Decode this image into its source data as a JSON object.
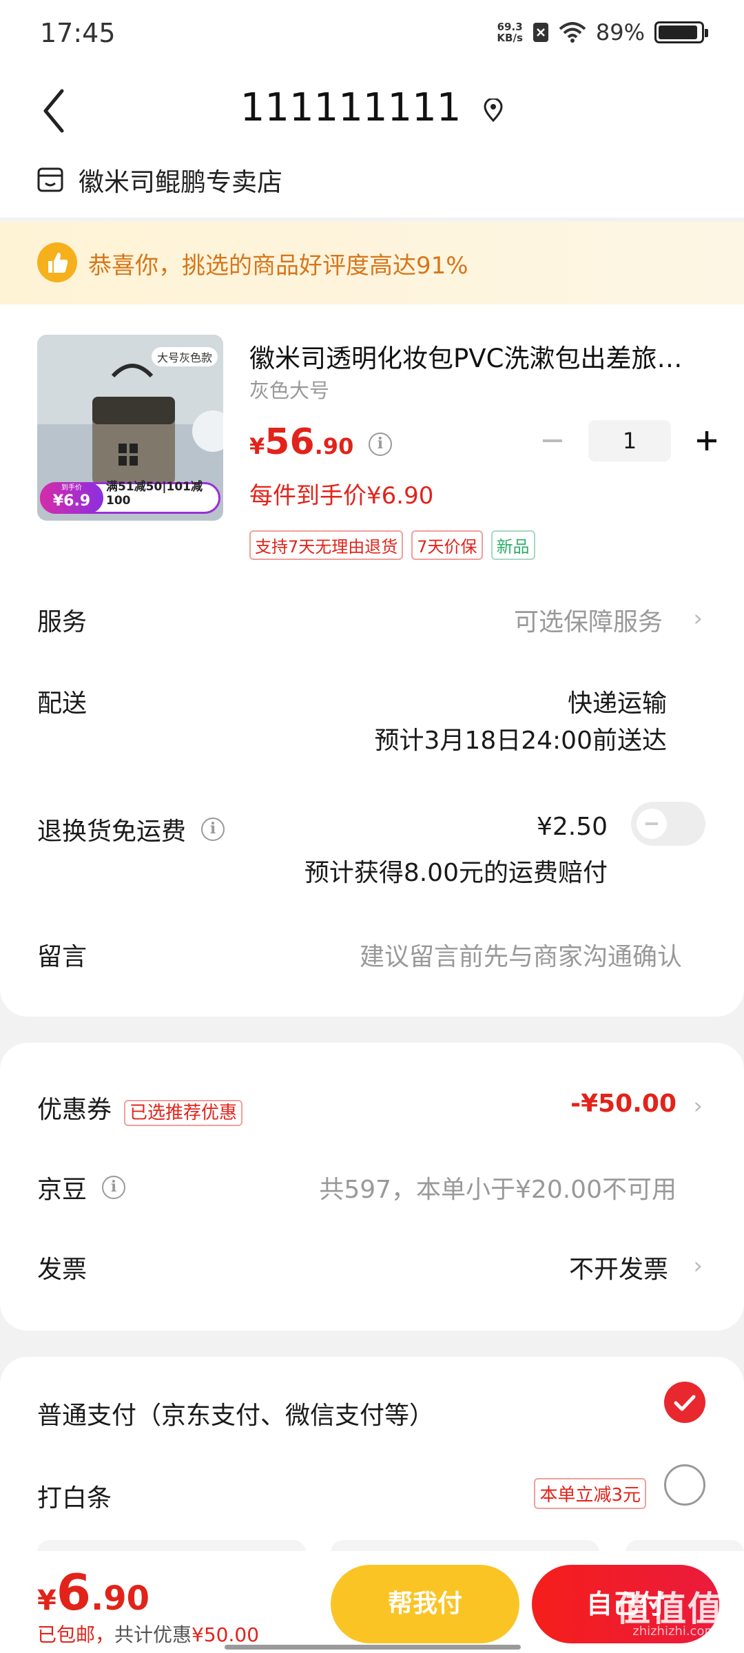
{
  "status_bar": {
    "time": "17:45",
    "speed_value": "69.3",
    "speed_unit": "KB/s",
    "battery": "89%"
  },
  "header": {
    "title": "111111111",
    "store_name": "徽米司鲲鹏专卖店"
  },
  "banner": {
    "text": "恭喜你，挑选的商品好评度高达91%"
  },
  "product": {
    "name": "徽米司透明化妆包PVC洗漱包出差旅…",
    "variant": "灰色大号",
    "price_symbol": "¥",
    "price_int": "56",
    "price_dec": ".90",
    "quantity": "1",
    "per_item_price": "每件到手价¥6.90",
    "tags": [
      "支持7天无理由退货",
      "7天价保",
      "新品"
    ],
    "image_badge": "大号灰色款",
    "image_price_label": "到手价",
    "image_price": "¥6.9",
    "image_promo": "满51减50|101减100"
  },
  "rows": {
    "service_label": "服务",
    "service_value": "可选保障服务",
    "delivery_label": "配送",
    "delivery_value": "快递运输",
    "delivery_eta": "预计3月18日24:00前送达",
    "return_label": "退换货免运费",
    "return_price": "¥2.50",
    "return_note": "预计获得8.00元的运费赔付",
    "message_label": "留言",
    "message_placeholder": "建议留言前先与商家沟通确认"
  },
  "discounts": {
    "coupon_label": "优惠券",
    "coupon_tag": "已选推荐优惠",
    "coupon_value": "-¥50.00",
    "jingdou_label": "京豆",
    "jingdou_value": "共597，本单小于¥20.00不可用",
    "invoice_label": "发票",
    "invoice_value": "不开发票"
  },
  "payment": {
    "normal_label": "普通支付（京东支付、微信支付等）",
    "baitiao_label": "打白条",
    "baitiao_tag": "本单立减3元"
  },
  "bottom": {
    "total_symbol": "¥",
    "total_int": "6",
    "total_dec": ".90",
    "shipping_note": "已包邮，",
    "discount_note": "共计优惠",
    "discount_amount": "¥50.00",
    "help_pay": "帮我付",
    "self_pay": "自己付"
  },
  "watermark": {
    "text": "值值值",
    "site": "zhizhizhi.com"
  },
  "colors": {
    "accent_red": "#e2231a",
    "help_yellow": "#fbc425",
    "banner_orange": "#d6761a"
  }
}
